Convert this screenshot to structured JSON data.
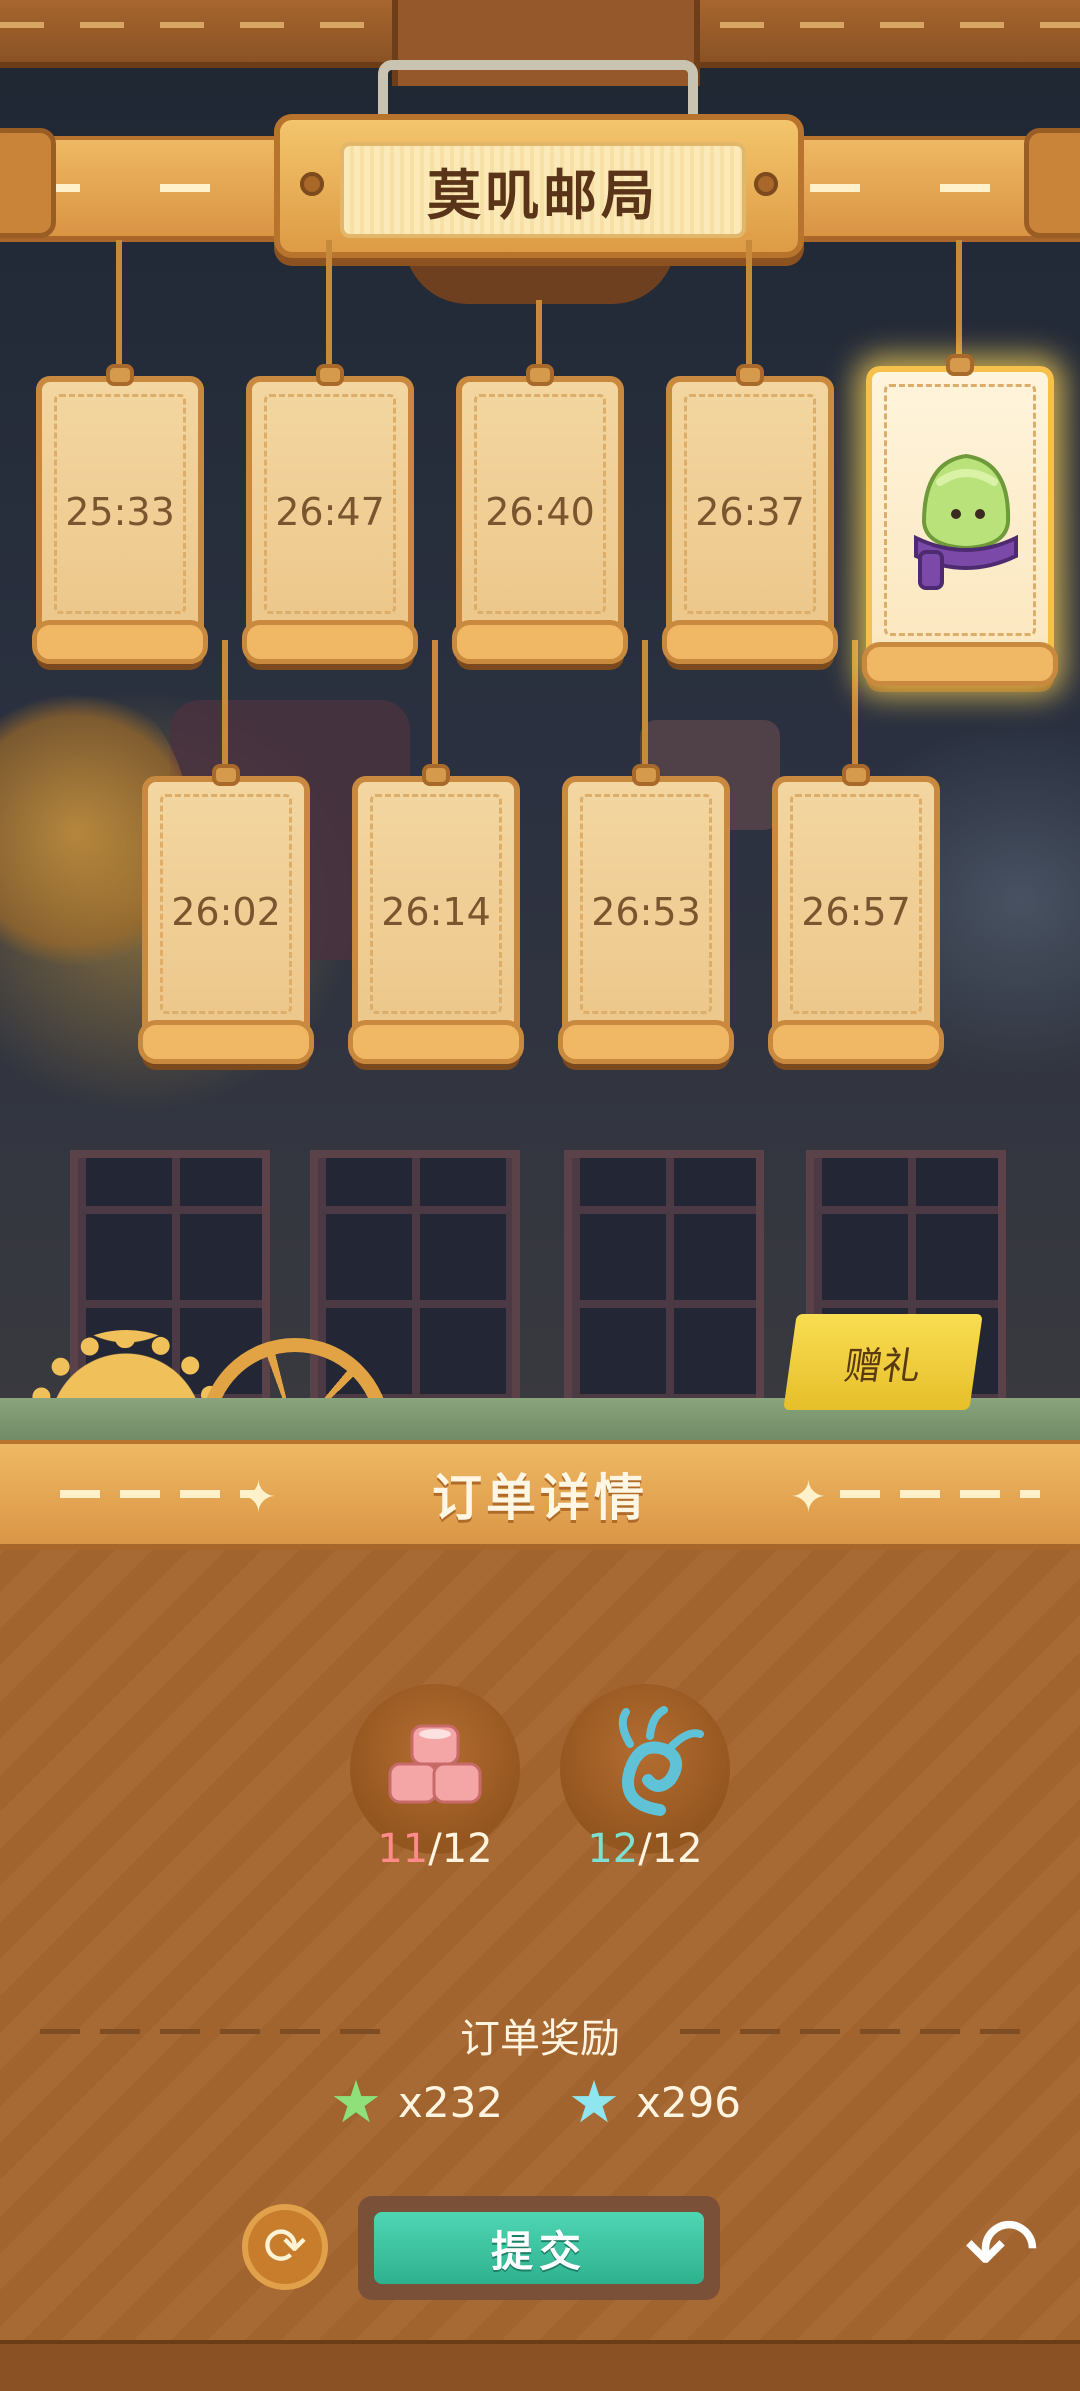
{
  "header": {
    "title": "莫叽邮局"
  },
  "orders": [
    {
      "time": "25:33"
    },
    {
      "time": "26:47"
    },
    {
      "time": "26:40"
    },
    {
      "time": "26:37"
    },
    {
      "time": "",
      "selected": true,
      "icon": "green-slime-with-scarf-icon"
    },
    {
      "time": "26:02"
    },
    {
      "time": "26:14"
    },
    {
      "time": "26:53"
    },
    {
      "time": "26:57"
    }
  ],
  "gift_label": "赠礼",
  "detail": {
    "title": "订单详情",
    "requirements": [
      {
        "icon": "pink-jelly-blocks-icon",
        "have": "11",
        "sep": "/",
        "need": "12",
        "have_color": "#ff8a8a"
      },
      {
        "icon": "blue-curl-vine-icon",
        "have": "12",
        "sep": "/",
        "need": "12",
        "have_color": "#7ee0d0"
      }
    ],
    "reward_title": "订单奖励",
    "rewards": [
      {
        "icon": "green-star-icon",
        "amount": "x232"
      },
      {
        "icon": "blue-star-icon",
        "amount": "x296"
      }
    ],
    "submit_label": "提交"
  },
  "colors": {
    "wood": "#a86a34",
    "rail": "#efb863",
    "submit": "#3fc4a1",
    "selected_glow": "#ffd65a"
  }
}
